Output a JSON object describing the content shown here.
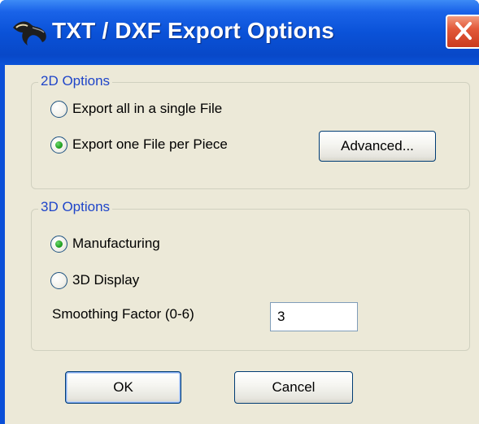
{
  "window": {
    "title": "TXT / DXF Export Options",
    "app_icon": "app-logo-icon",
    "close_icon": "close-icon"
  },
  "options_2d": {
    "legend": "2D Options",
    "radio_single_file": {
      "label": "Export all in a single File",
      "checked": false
    },
    "radio_per_piece": {
      "label": "Export one File per Piece",
      "checked": true
    },
    "advanced_button": "Advanced..."
  },
  "options_3d": {
    "legend": "3D Options",
    "radio_manufacturing": {
      "label": "Manufacturing",
      "checked": true
    },
    "radio_3d_display": {
      "label": "3D Display",
      "checked": false
    },
    "smoothing_label": "Smoothing Factor (0-6)",
    "smoothing_value": "3"
  },
  "buttons": {
    "ok": "OK",
    "cancel": "Cancel"
  },
  "colors": {
    "titlebar": "#0a52d8",
    "client_bg": "#ece9d8",
    "group_label": "#1f45c9",
    "close_button": "#e35a3a",
    "radio_dot": "#21a121"
  }
}
